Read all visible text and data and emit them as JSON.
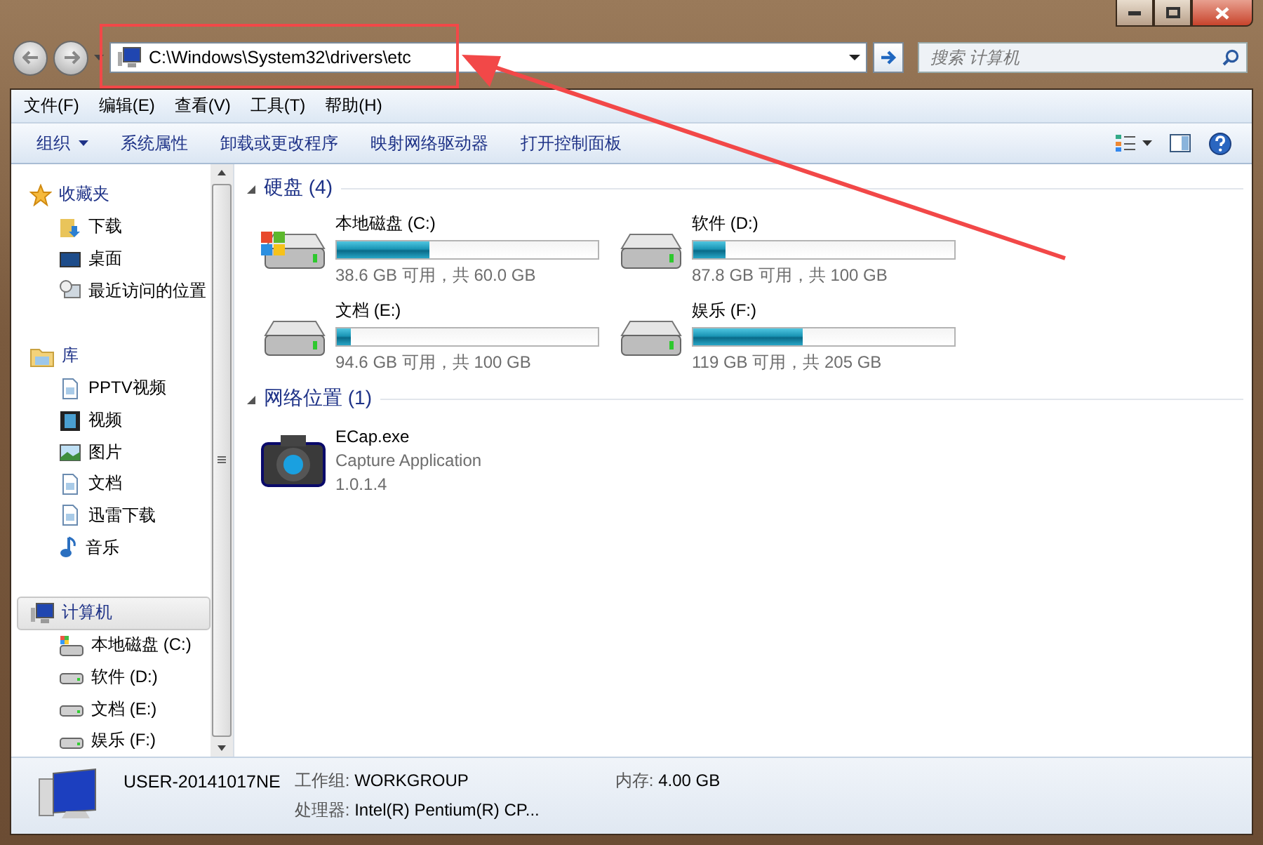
{
  "address": {
    "path": "C:\\Windows\\System32\\drivers\\etc"
  },
  "search": {
    "placeholder": "搜索 计算机"
  },
  "menu": [
    "文件(F)",
    "编辑(E)",
    "查看(V)",
    "工具(T)",
    "帮助(H)"
  ],
  "commands": [
    {
      "label": "组织",
      "kind": "dropdown"
    },
    {
      "label": "系统属性",
      "kind": "plain"
    },
    {
      "label": "卸载或更改程序",
      "kind": "plain"
    },
    {
      "label": "映射网络驱动器",
      "kind": "plain"
    },
    {
      "label": "打开控制面板",
      "kind": "plain"
    }
  ],
  "sidebar": [
    {
      "label": "收藏夹",
      "kind": "star",
      "selected": false,
      "children": [
        {
          "label": "下载",
          "kind": "download",
          "selected": false
        },
        {
          "label": "桌面",
          "kind": "desktop",
          "selected": false
        },
        {
          "label": "最近访问的位置",
          "kind": "recent",
          "selected": false
        }
      ]
    },
    {
      "label": "库",
      "kind": "library",
      "selected": false,
      "children": [
        {
          "label": "PPTV视频",
          "kind": "doc",
          "selected": false
        },
        {
          "label": "视频",
          "kind": "video",
          "selected": false
        },
        {
          "label": "图片",
          "kind": "image",
          "selected": false
        },
        {
          "label": "文档",
          "kind": "doc",
          "selected": false
        },
        {
          "label": "迅雷下载",
          "kind": "doc",
          "selected": false
        },
        {
          "label": "音乐",
          "kind": "music",
          "selected": false
        }
      ]
    },
    {
      "label": "计算机",
      "kind": "computer",
      "selected": true,
      "children": [
        {
          "label": "本地磁盘 (C:)",
          "kind": "sysdrive",
          "selected": false
        },
        {
          "label": "软件 (D:)",
          "kind": "drive",
          "selected": false
        },
        {
          "label": "文档 (E:)",
          "kind": "drive",
          "selected": false
        },
        {
          "label": "娱乐 (F:)",
          "kind": "drive",
          "selected": false
        }
      ]
    }
  ],
  "groups": [
    {
      "title": "硬盘 (4)",
      "expanded": true,
      "items": [
        {
          "kind": "sysdrive",
          "name": "本地磁盘 (C:)",
          "level": 0.357,
          "reading": "38.6 GB 可用，共 60.0 GB"
        },
        {
          "kind": "drive",
          "name": "软件 (D:)",
          "level": 0.122,
          "reading": "87.8 GB 可用，共 100 GB"
        },
        {
          "kind": "drive",
          "name": "文档 (E:)",
          "level": 0.054,
          "reading": "94.6 GB 可用，共 100 GB"
        },
        {
          "kind": "drive",
          "name": "娱乐 (F:)",
          "level": 0.42,
          "reading": "119 GB 可用，共 205 GB"
        }
      ]
    },
    {
      "title": "网络位置 (1)",
      "expanded": true,
      "items": [
        {
          "kind": "app",
          "name": "ECap.exe",
          "lines": [
            "Capture Application",
            "1.0.1.4"
          ]
        }
      ]
    }
  ],
  "details": {
    "name": "USER-20141017NE",
    "rows": [
      [
        {
          "label": "工作组:",
          "value": "WORKGROUP"
        },
        {
          "label": "内存:",
          "value": "4.00 GB"
        }
      ],
      [
        {
          "label": "处理器:",
          "value": "Intel(R) Pentium(R) CP..."
        }
      ]
    ]
  }
}
